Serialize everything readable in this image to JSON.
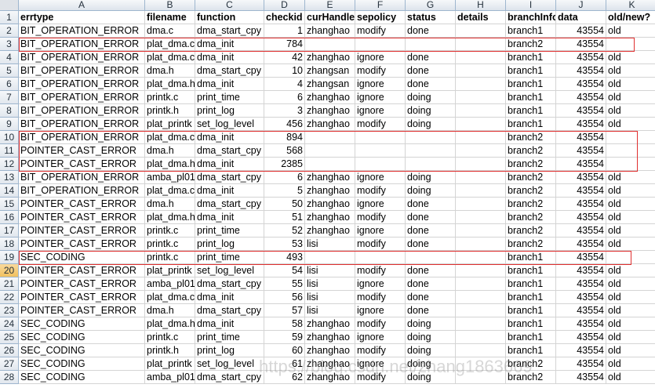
{
  "columns": [
    "A",
    "B",
    "C",
    "D",
    "E",
    "F",
    "G",
    "H",
    "I",
    "J",
    "K"
  ],
  "headers": [
    "errtype",
    "filename",
    "function",
    "checkid",
    "curHandler",
    "sepolicy",
    "status",
    "details",
    "branchInfo",
    "data",
    "old/new?"
  ],
  "rows": [
    [
      "BIT_OPERATION_ERROR",
      "dma.c",
      "dma_start_cpy",
      "1",
      "zhanghao",
      "modify",
      "done",
      "",
      "branch1",
      "43554",
      "old"
    ],
    [
      "BIT_OPERATION_ERROR",
      "plat_dma.c",
      "dma_init",
      "784",
      "",
      "",
      "",
      "",
      "branch2",
      "43554",
      ""
    ],
    [
      "BIT_OPERATION_ERROR",
      "plat_dma.c",
      "dma_init",
      "42",
      "zhanghao",
      "ignore",
      "done",
      "",
      "branch1",
      "43554",
      "old"
    ],
    [
      "BIT_OPERATION_ERROR",
      "dma.h",
      "dma_start_cpy",
      "10",
      "zhangsan",
      "modify",
      "done",
      "",
      "branch1",
      "43554",
      "old"
    ],
    [
      "BIT_OPERATION_ERROR",
      "plat_dma.h",
      "dma_init",
      "4",
      "zhangsan",
      "ignore",
      "done",
      "",
      "branch1",
      "43554",
      "old"
    ],
    [
      "BIT_OPERATION_ERROR",
      "printk.c",
      "print_time",
      "6",
      "zhanghao",
      "ignore",
      "doing",
      "",
      "branch1",
      "43554",
      "old"
    ],
    [
      "BIT_OPERATION_ERROR",
      "printk.h",
      "print_log",
      "3",
      "zhanghao",
      "ignore",
      "doing",
      "",
      "branch1",
      "43554",
      "old"
    ],
    [
      "BIT_OPERATION_ERROR",
      "plat_printk",
      "set_log_level",
      "456",
      "zhanghao",
      "modify",
      "doing",
      "",
      "branch1",
      "43554",
      "old"
    ],
    [
      "BIT_OPERATION_ERROR",
      "plat_dma.c",
      "dma_init",
      "894",
      "",
      "",
      "",
      "",
      "branch2",
      "43554",
      ""
    ],
    [
      "POINTER_CAST_ERROR",
      "dma.h",
      "dma_start_cpy",
      "568",
      "",
      "",
      "",
      "",
      "branch2",
      "43554",
      ""
    ],
    [
      "POINTER_CAST_ERROR",
      "plat_dma.h",
      "dma_init",
      "2385",
      "",
      "",
      "",
      "",
      "branch2",
      "43554",
      ""
    ],
    [
      "BIT_OPERATION_ERROR",
      "amba_pl01",
      "dma_start_cpy",
      "6",
      "zhanghao",
      "ignore",
      "doing",
      "",
      "branch2",
      "43554",
      "old"
    ],
    [
      "BIT_OPERATION_ERROR",
      "plat_dma.c",
      "dma_init",
      "5",
      "zhanghao",
      "modify",
      "doing",
      "",
      "branch2",
      "43554",
      "old"
    ],
    [
      "POINTER_CAST_ERROR",
      "dma.h",
      "dma_start_cpy",
      "50",
      "zhanghao",
      "ignore",
      "done",
      "",
      "branch2",
      "43554",
      "old"
    ],
    [
      "POINTER_CAST_ERROR",
      "plat_dma.h",
      "dma_init",
      "51",
      "zhanghao",
      "modify",
      "done",
      "",
      "branch2",
      "43554",
      "old"
    ],
    [
      "POINTER_CAST_ERROR",
      "printk.c",
      "print_time",
      "52",
      "zhanghao",
      "ignore",
      "done",
      "",
      "branch2",
      "43554",
      "old"
    ],
    [
      "POINTER_CAST_ERROR",
      "printk.c",
      "print_log",
      "53",
      "lisi",
      "modify",
      "done",
      "",
      "branch2",
      "43554",
      "old"
    ],
    [
      "SEC_CODING",
      "printk.c",
      "print_time",
      "493",
      "",
      "",
      "",
      "",
      "branch1",
      "43554",
      ""
    ],
    [
      "POINTER_CAST_ERROR",
      "plat_printk",
      "set_log_level",
      "54",
      "lisi",
      "modify",
      "done",
      "",
      "branch1",
      "43554",
      "old"
    ],
    [
      "POINTER_CAST_ERROR",
      "amba_pl01",
      "dma_start_cpy",
      "55",
      "lisi",
      "ignore",
      "done",
      "",
      "branch1",
      "43554",
      "old"
    ],
    [
      "POINTER_CAST_ERROR",
      "plat_dma.c",
      "dma_init",
      "56",
      "lisi",
      "modify",
      "done",
      "",
      "branch1",
      "43554",
      "old"
    ],
    [
      "POINTER_CAST_ERROR",
      "dma.h",
      "dma_start_cpy",
      "57",
      "lisi",
      "ignore",
      "done",
      "",
      "branch1",
      "43554",
      "old"
    ],
    [
      "SEC_CODING",
      "plat_dma.h",
      "dma_init",
      "58",
      "zhanghao",
      "modify",
      "doing",
      "",
      "branch1",
      "43554",
      "old"
    ],
    [
      "SEC_CODING",
      "printk.c",
      "print_time",
      "59",
      "zhanghao",
      "ignore",
      "doing",
      "",
      "branch1",
      "43554",
      "old"
    ],
    [
      "SEC_CODING",
      "printk.h",
      "print_log",
      "60",
      "zhanghao",
      "modify",
      "doing",
      "",
      "branch1",
      "43554",
      "old"
    ],
    [
      "SEC_CODING",
      "plat_printk",
      "set_log_level",
      "61",
      "zhanghao",
      "ignore",
      "doing",
      "",
      "branch2",
      "43554",
      "old"
    ],
    [
      "SEC_CODING",
      "amba_pl01",
      "dma_start_cpy",
      "62",
      "zhanghao",
      "modify",
      "doing",
      "",
      "branch2",
      "43554",
      "old"
    ]
  ],
  "selected_row": 20,
  "watermark": "https://blog.csdn.net/zhang1863669"
}
